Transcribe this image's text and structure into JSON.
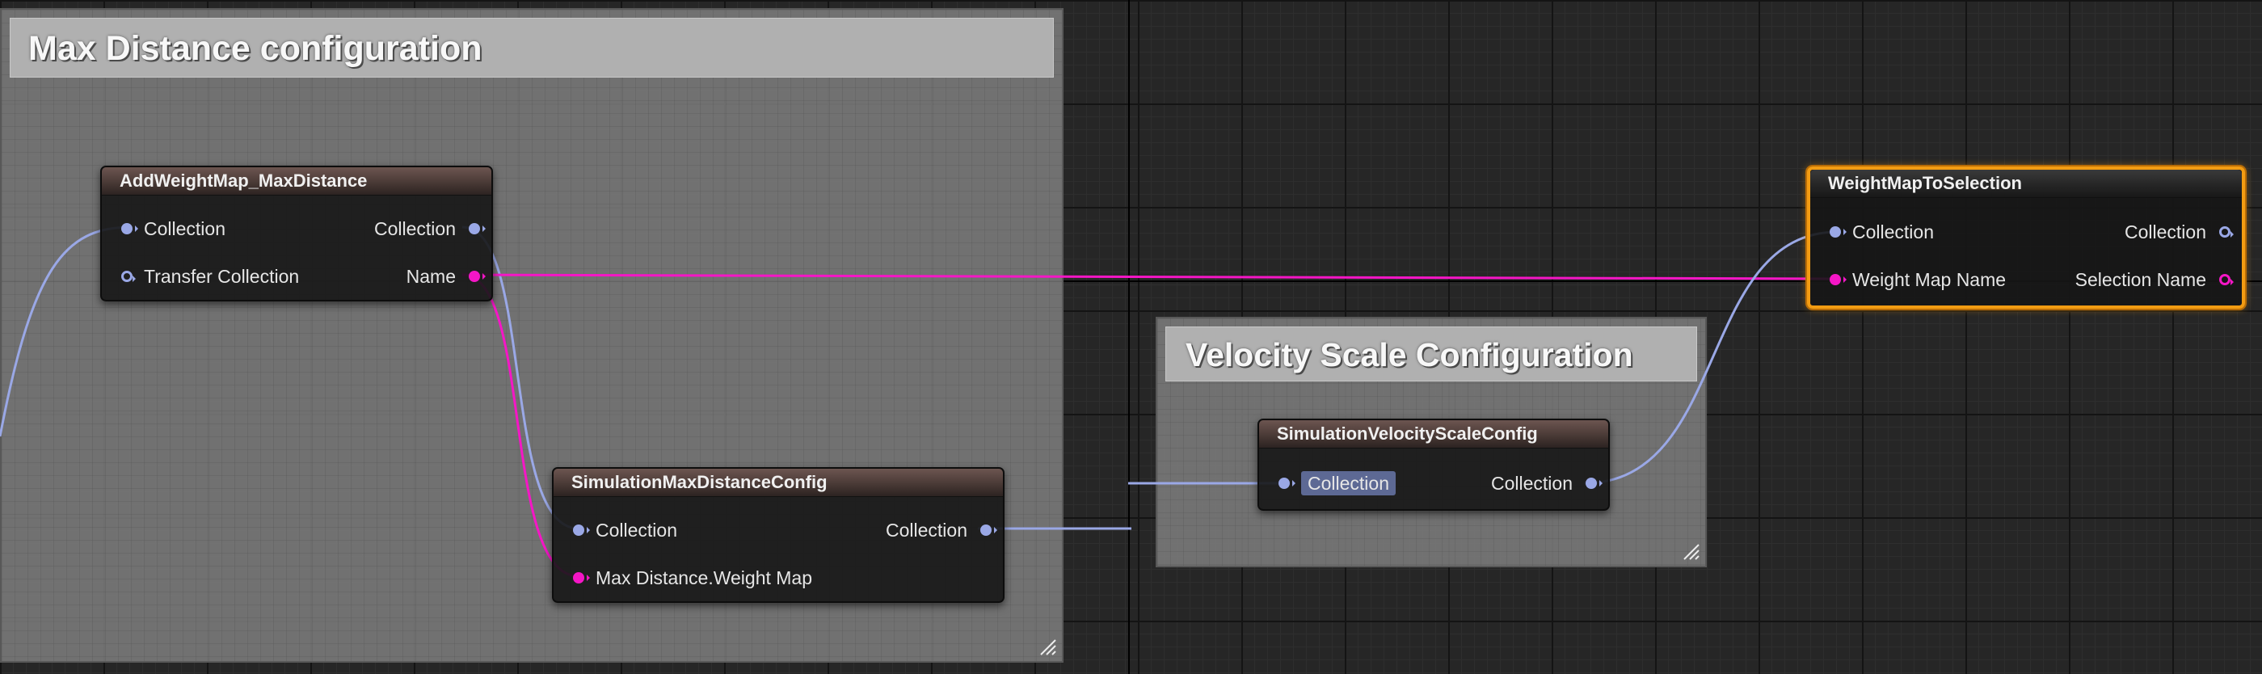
{
  "comments": {
    "max_distance": {
      "title": "Max Distance configuration"
    },
    "velocity_scale": {
      "title": "Velocity Scale Configuration"
    }
  },
  "nodes": {
    "add_weight_map": {
      "title": "AddWeightMap_MaxDistance",
      "inputs": [
        "Collection",
        "Transfer Collection"
      ],
      "outputs": [
        "Collection",
        "Name"
      ]
    },
    "sim_max_distance": {
      "title": "SimulationMaxDistanceConfig",
      "inputs": [
        "Collection",
        "Max Distance.Weight Map"
      ],
      "outputs": [
        "Collection"
      ]
    },
    "sim_velocity_scale": {
      "title": "SimulationVelocityScaleConfig",
      "inputs": [
        "Collection"
      ],
      "outputs": [
        "Collection"
      ]
    },
    "weight_map_to_selection": {
      "title": "WeightMapToSelection",
      "inputs": [
        "Collection",
        "Weight Map Name"
      ],
      "outputs": [
        "Collection",
        "Selection Name"
      ]
    }
  },
  "colors": {
    "collection_pin": "#9aa8e6",
    "name_pin": "#f516c6",
    "selection_outline": "#f39c12",
    "graph_background": "#262626"
  }
}
